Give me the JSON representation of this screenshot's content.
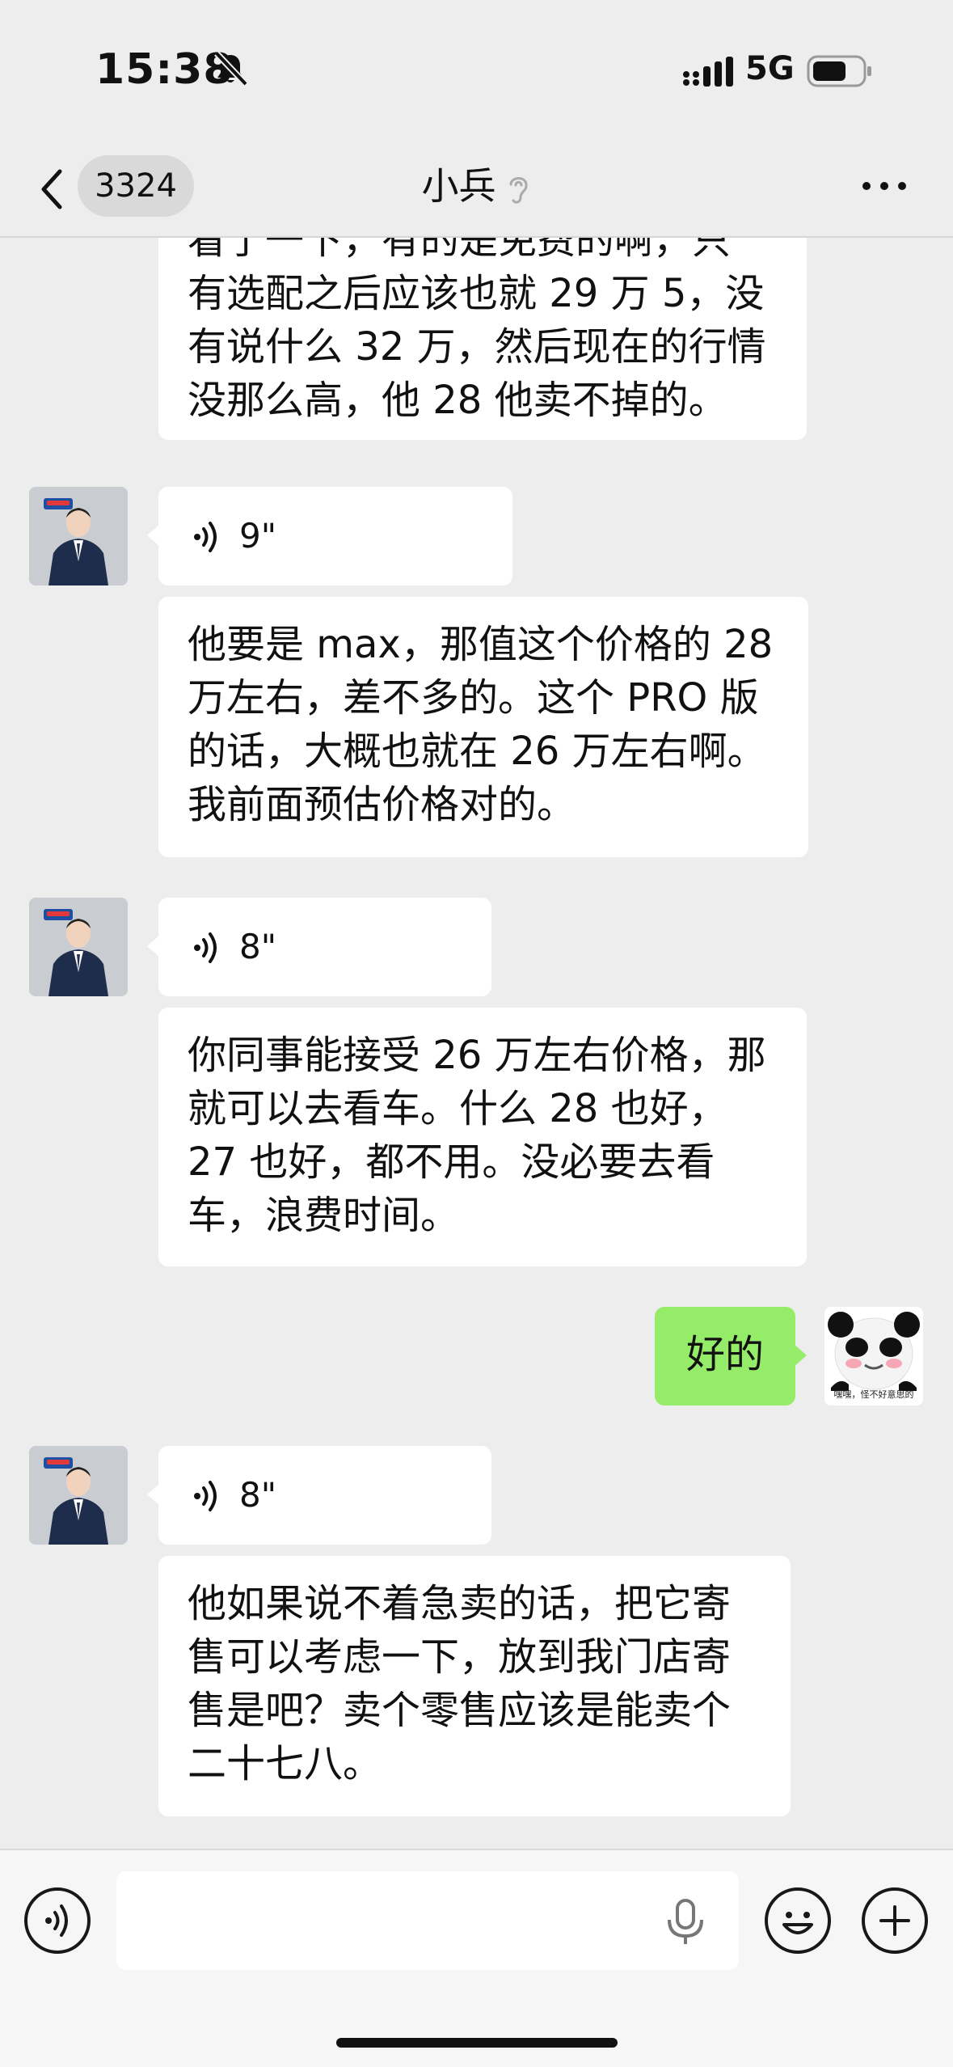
{
  "status_bar": {
    "time": "15:38",
    "network": "5G"
  },
  "nav": {
    "unread_count": "3324",
    "title": "小兵"
  },
  "messages": {
    "m0": {
      "lines": [
        "看了一下，有的是免费的啊，只",
        "有选配之后应该也就 29 万 5，没",
        "有说什么 32 万，然后现在的行情",
        "没那么高，他 28 他卖不掉的。"
      ]
    },
    "v1": {
      "duration": "9\""
    },
    "m1": {
      "lines": [
        "他要是 max，那值这个价格的 28",
        "万左右，差不多的。这个 PRO 版",
        "的话，大概也就在 26 万左右啊。",
        "我前面预估价格对的。"
      ]
    },
    "v2": {
      "duration": "8\""
    },
    "m2": {
      "lines": [
        "你同事能接受 26 万左右价格，那",
        "就可以去看车。什么 28 也好，",
        "27 也好，都不用。没必要去看",
        "车，浪费时间。"
      ]
    },
    "out1": {
      "text": "好的"
    },
    "v3": {
      "duration": "8\""
    },
    "m3": {
      "lines": [
        "他如果说不着急卖的话，把它寄",
        "售可以考虑一下，放到我门店寄",
        "售是吧？卖个零售应该是能卖个",
        "二十七八。"
      ]
    }
  },
  "my_avatar": {
    "caption": "嘿嘿，怪不好意思的"
  },
  "colors": {
    "background": "#ededed",
    "incoming_bubble": "#ffffff",
    "outgoing_bubble": "#95ec69"
  },
  "icons": [
    "bell-slash-icon",
    "signal-icon",
    "battery-icon",
    "back-chevron-icon",
    "ear-icon",
    "more-icon",
    "voice-wave-icon",
    "voice-mode-icon",
    "mic-icon",
    "emoji-icon",
    "plus-icon"
  ]
}
